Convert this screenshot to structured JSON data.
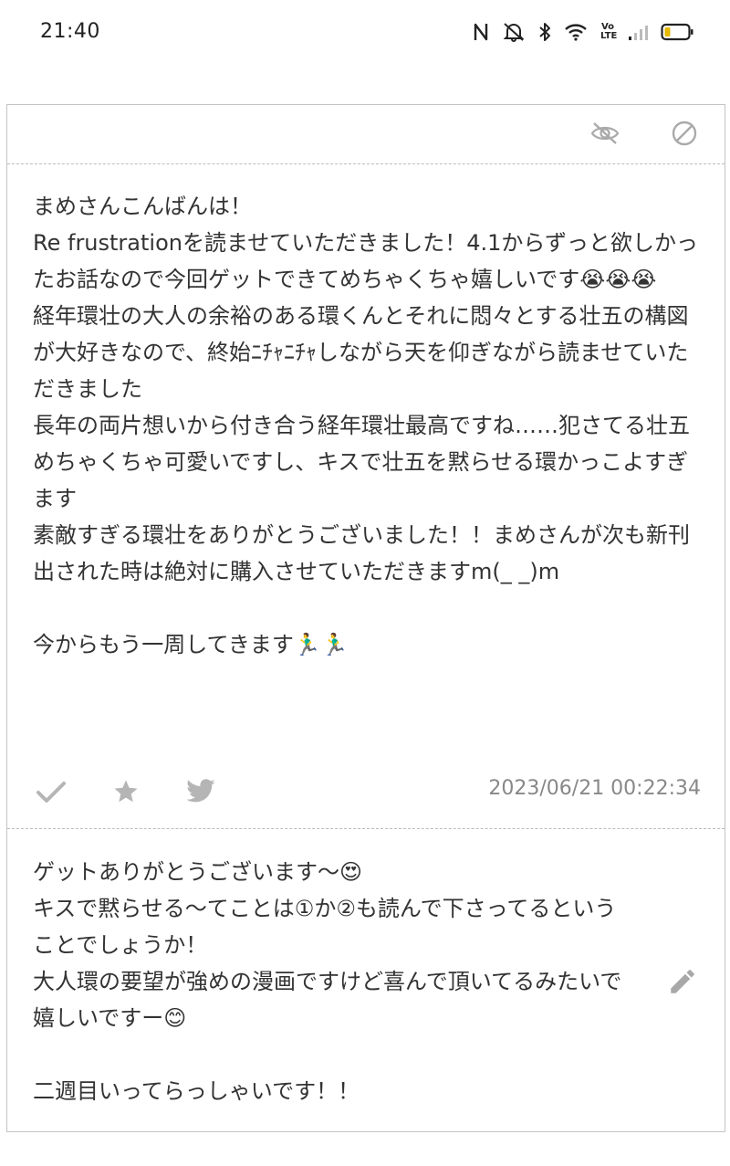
{
  "status_bar": {
    "time": "21:40",
    "volte_label": "Vo\nLTE",
    "icons": [
      "nfc-icon",
      "mute-icon",
      "bluetooth-icon",
      "wifi-icon",
      "volte-icon",
      "signal-icon",
      "battery-icon"
    ]
  },
  "header": {
    "icons": [
      "eye-off-icon",
      "block-icon"
    ]
  },
  "message": {
    "text": "まめさんこんばんは！\nRe frustrationを読ませていただきました！4.1からずっと欲しかったお話なので今回ゲットできてめちゃくちゃ嬉しいです😭😭😭\n経年環壮の大人の余裕のある環くんとそれに悶々とする壮五の構図が大好きなので、終始ﾆﾁｬﾆﾁｬしながら天を仰ぎながら読ませていただきました\n長年の両片想いから付き合う経年環壮最高ですね……犯さてる壮五めちゃくちゃ可愛いですし、キスで壮五を黙らせる環かっこよすぎます\n素敵すぎる環壮をありがとうございました！！まめさんが次も新刊出された時は絶対に購入させていただきますm(_ _)m\n\n今からもう一周してきます🏃‍♂️🏃‍♂️",
    "timestamp": "2023/06/21 00:22:34",
    "actions": [
      "check-icon",
      "star-icon",
      "twitter-icon"
    ]
  },
  "reply": {
    "text": "ゲットありがとうございます〜😍\nキスで黙らせる〜てことは①か②も読んで下さってるということでしょうか！\n大人環の要望が強めの漫画ですけど喜んで頂いてるみたいで嬉しいですー😊\n\n二週目いってらっしゃいです！！",
    "edit_icon": "pencil-icon"
  },
  "colors": {
    "text": "#333333",
    "icon_gray": "#b5b5b5",
    "timestamp": "#888888",
    "border": "#c4c4c4"
  }
}
